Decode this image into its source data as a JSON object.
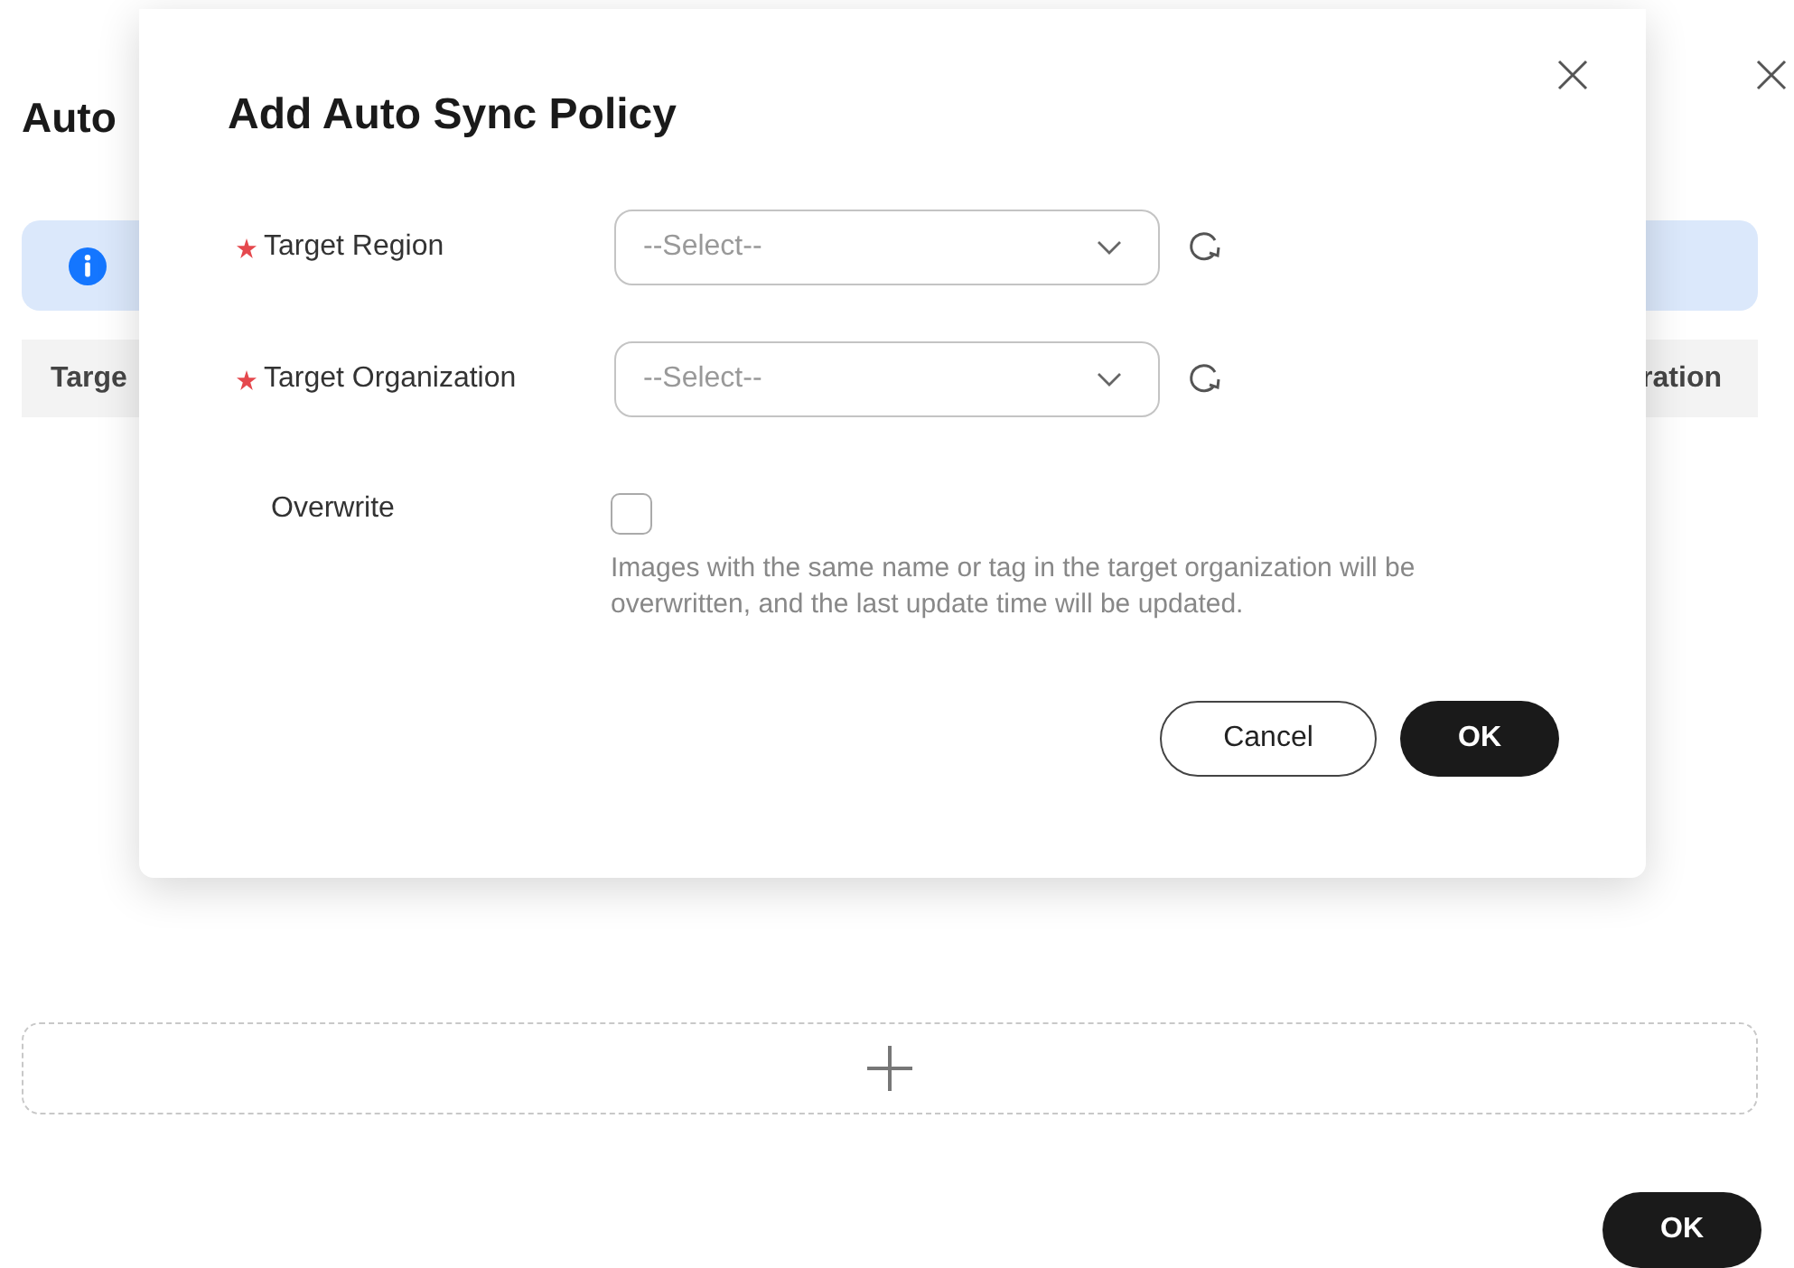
{
  "page": {
    "title": "Auto",
    "table": {
      "columns": [
        "Targe",
        "ration"
      ]
    },
    "buttons": [
      "OK"
    ]
  },
  "dialog": {
    "title": "Add Auto Sync Policy",
    "fields": [
      {
        "kind": "select",
        "label": "Target Region",
        "required": true,
        "placeholder": "--Select--"
      },
      {
        "kind": "select",
        "label": "Target Organization",
        "required": true,
        "placeholder": "--Select--"
      },
      {
        "kind": "checkbox",
        "label": "Overwrite",
        "required": false,
        "checked": false,
        "help": "Images with the same name or tag in the target organization will be overwritten, and the last update time will be updated."
      }
    ],
    "buttons": [
      {
        "label": "Cancel",
        "kind": "secondary"
      },
      {
        "label": "OK",
        "kind": "primary"
      }
    ]
  }
}
